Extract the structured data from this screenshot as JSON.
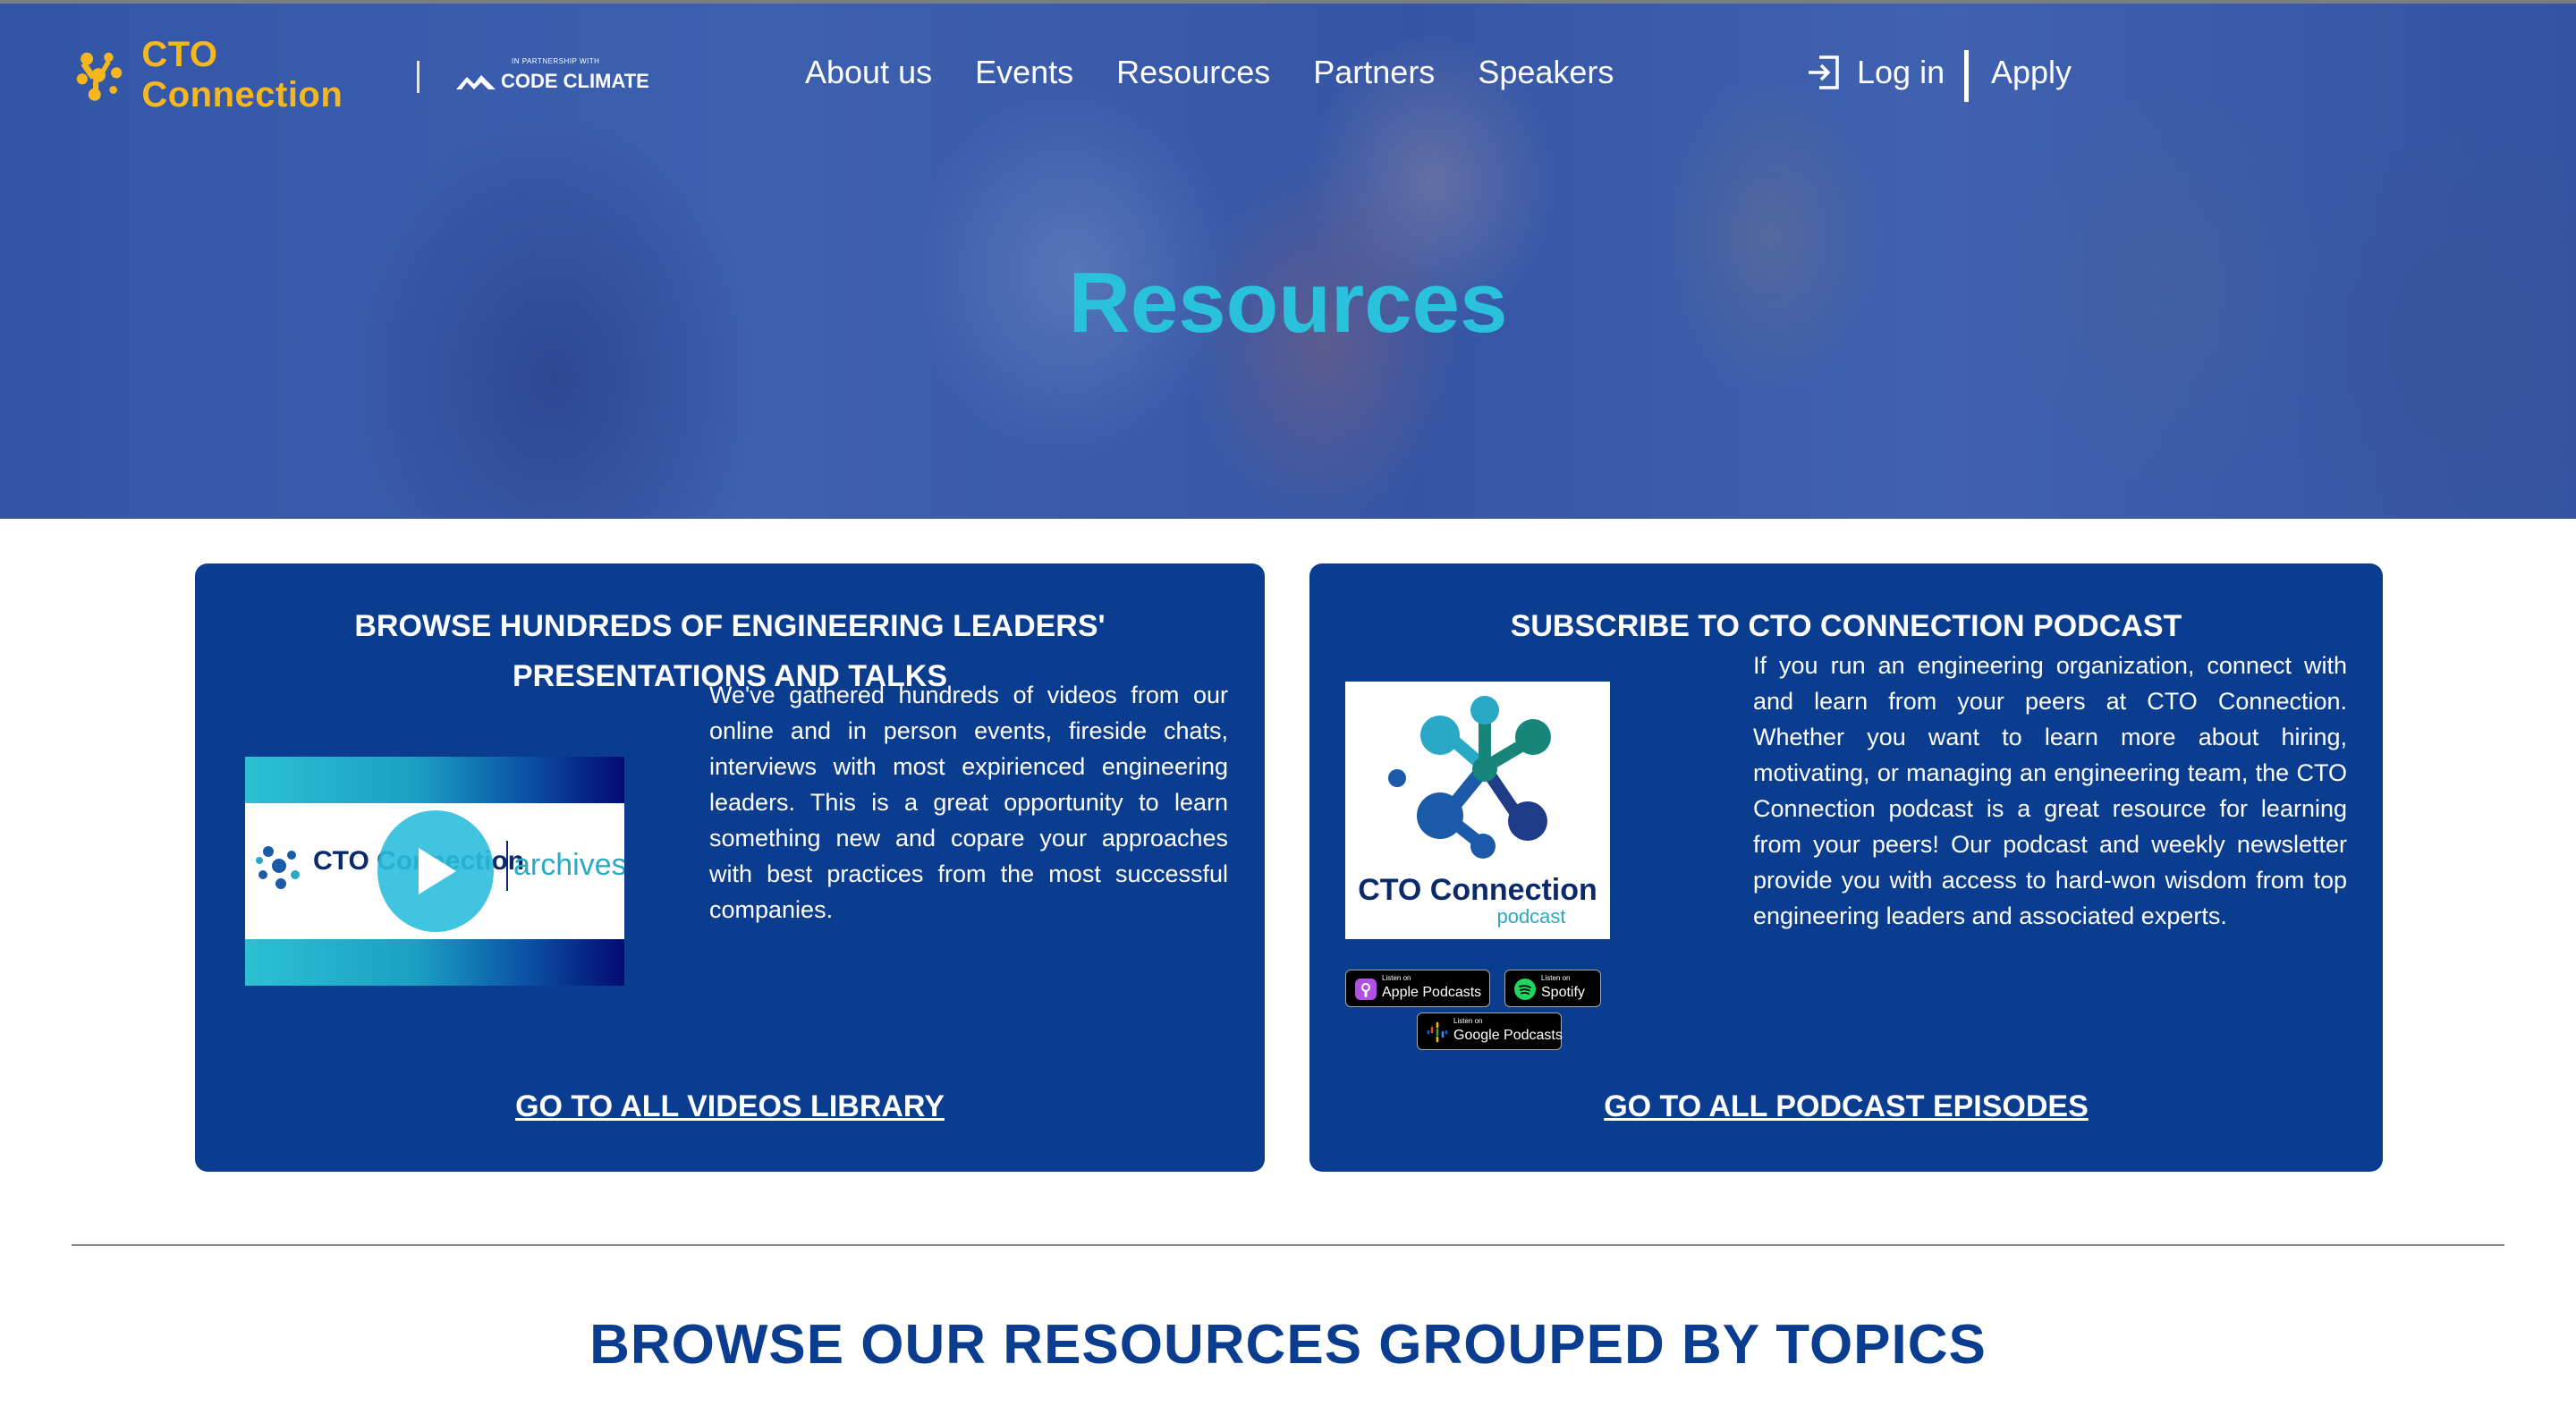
{
  "header": {
    "logo_text": "CTO Connection",
    "partner_small": "IN PARTNERSHIP WITH",
    "partner_name": "CODE CLIMATE",
    "nav": [
      "About us",
      "Events",
      "Resources",
      "Partners",
      "Speakers"
    ],
    "login_label": "Log in",
    "apply_label": "Apply"
  },
  "hero": {
    "title": "Resources"
  },
  "videos_card": {
    "title_line1": "BROWSE HUNDREDS OF ENGINEERING LEADERS'",
    "title_line2": "PRESENTATIONS AND TALKS",
    "thumb_brand": "CTO Connection",
    "thumb_archives": "archives",
    "body": "We've gathered hundreds of videos from our online and in person events, fireside chats, interviews with most expirienced engineering leaders. This is a great opportunity to learn something new and copare your approaches with best practices from the most successful companies.",
    "link": "GO TO ALL VIDEOS LIBRARY"
  },
  "podcast_card": {
    "title": "SUBSCRIBE TO CTO CONNECTION PODCAST",
    "cover_title": "CTO Connection",
    "cover_sub": "podcast",
    "body": "If you run an engineering organization, connect with and learn from your peers at CTO Connection. Whether you want to learn more about hiring, motivating, or managing an engineering team, the CTO Connection podcast is a great resource for learning from your peers! Our podcast and weekly newsletter provide you with access to hard-won wisdom from top engineering leaders and associated experts.",
    "badges": [
      {
        "small": "Listen on",
        "name": "Apple Podcasts"
      },
      {
        "small": "Listen on",
        "name": "Spotify"
      },
      {
        "small": "Listen on",
        "name": "Google Podcasts"
      }
    ],
    "link": "GO TO ALL PODCAST EPISODES"
  },
  "topics": {
    "title": "BROWSE OUR RESOURCES GROUPED BY TOPICS"
  },
  "colors": {
    "navy": "#0a3d8f",
    "cyan": "#29c1dc",
    "gold": "#f6b71e"
  }
}
